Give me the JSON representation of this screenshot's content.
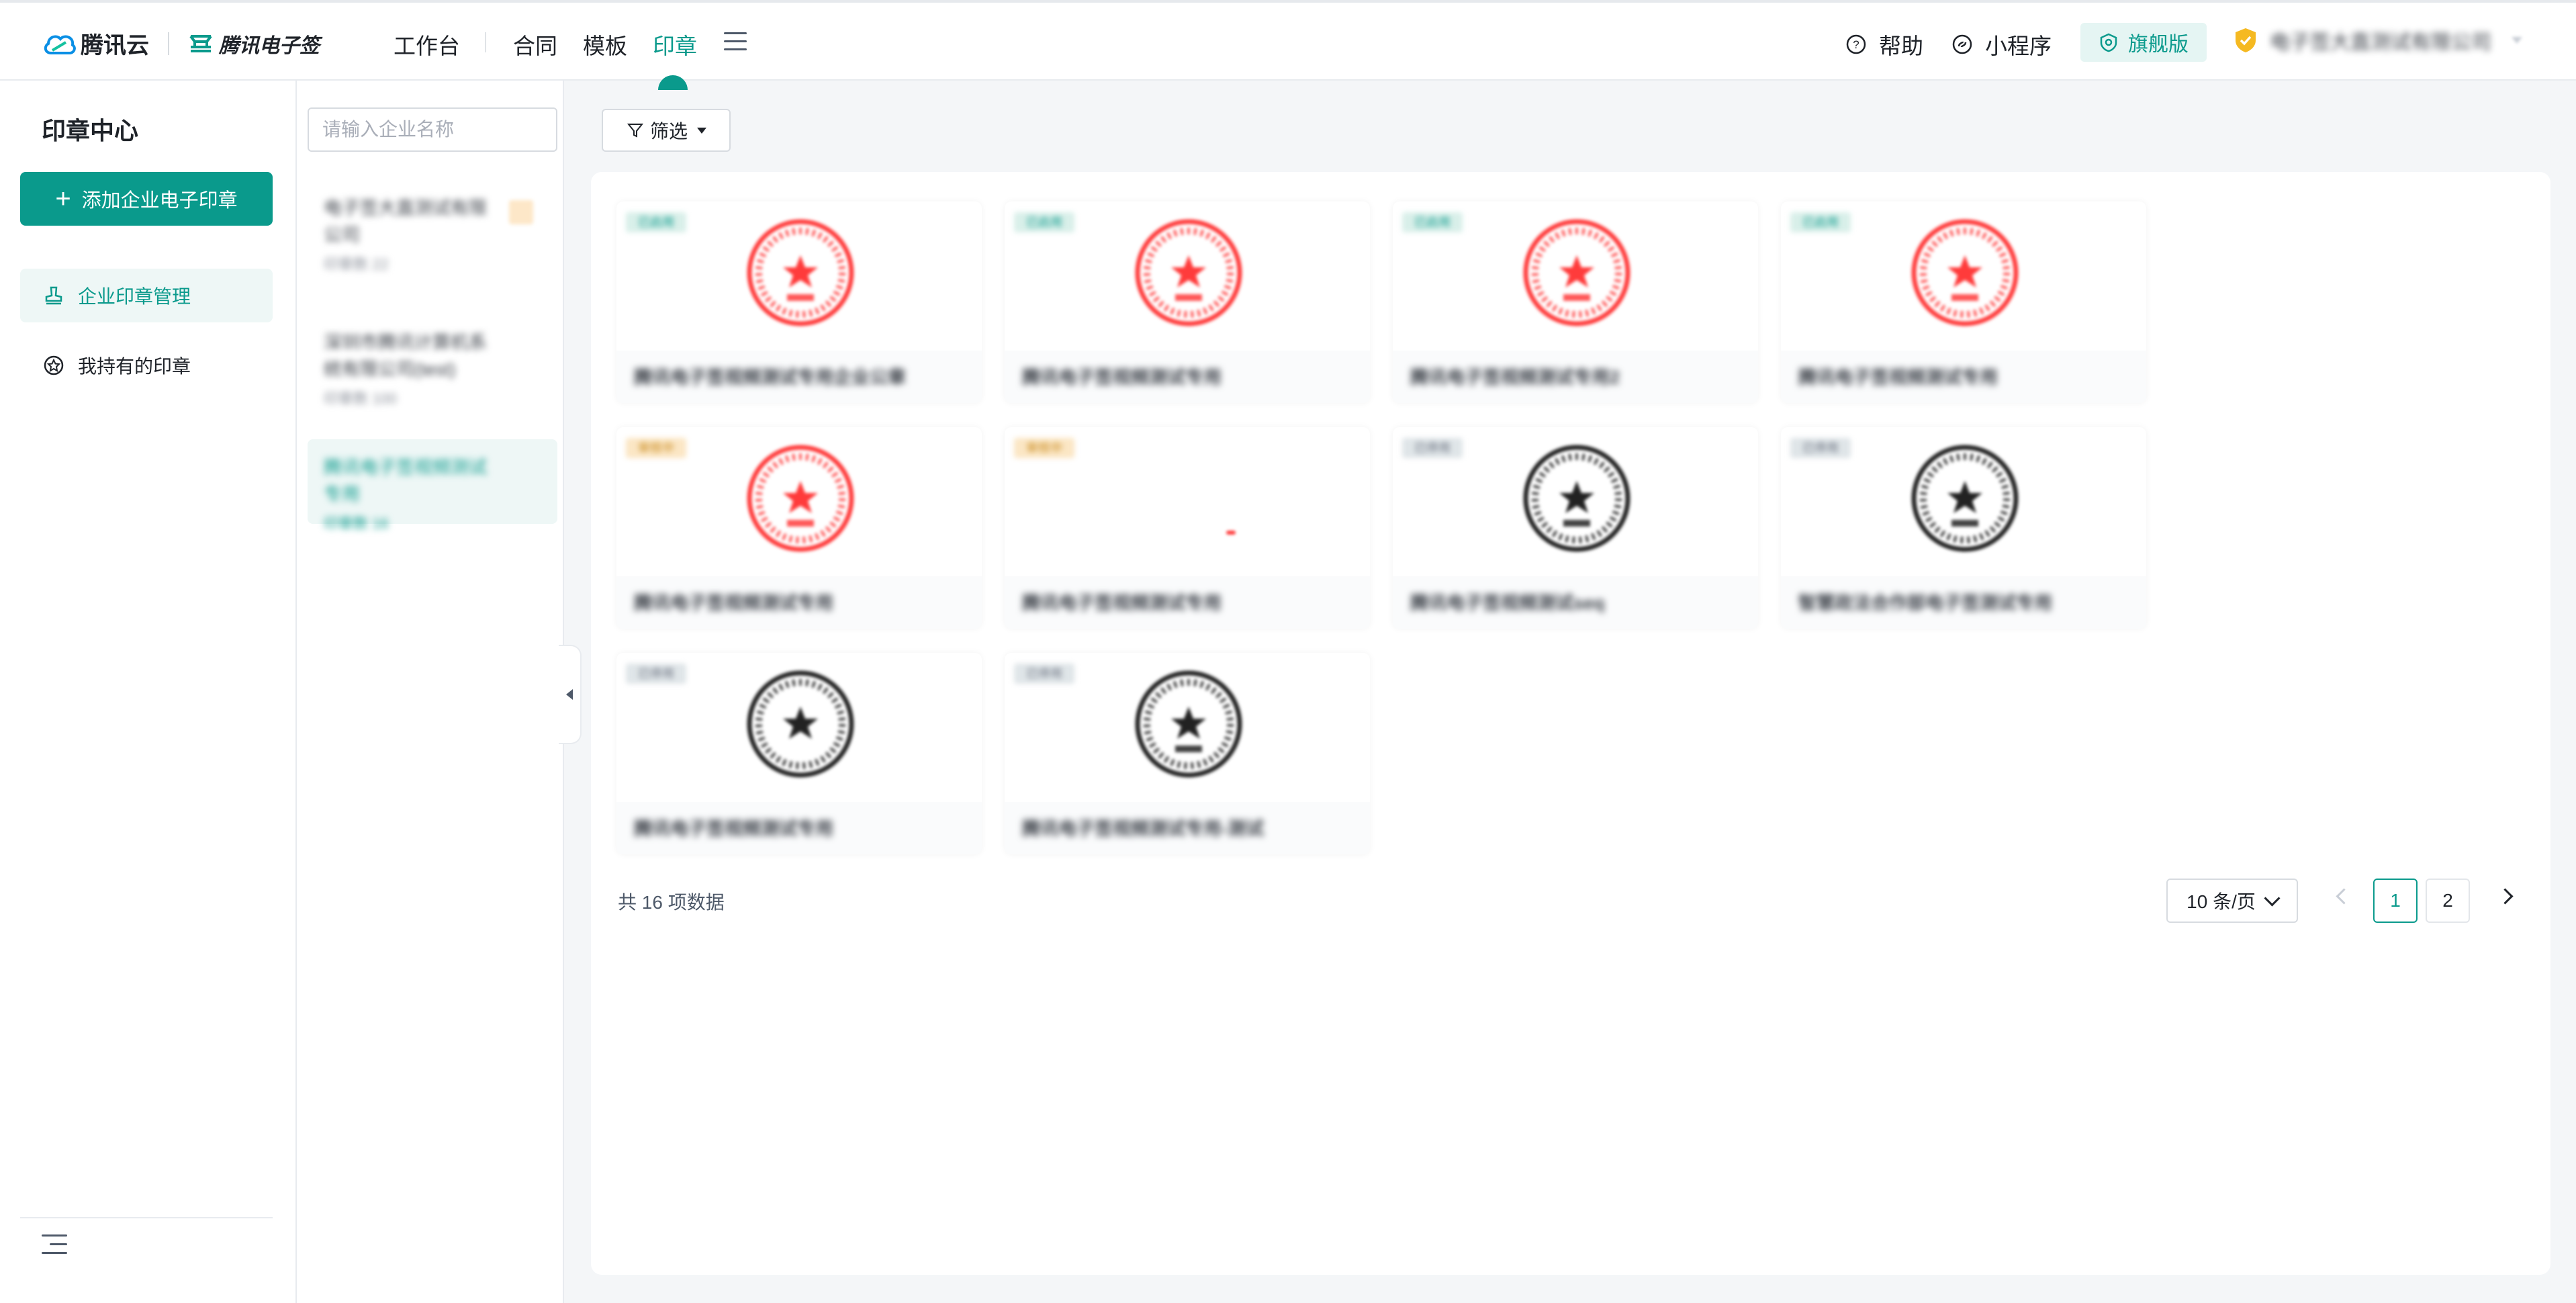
{
  "header": {
    "brand": "腾讯云",
    "product": "腾讯电子签",
    "workbench": "工作台",
    "nav": [
      "合同",
      "模板",
      "印章"
    ],
    "active_nav": "印章",
    "help": "帮助",
    "mini_program": "小程序",
    "edition": "旗舰版",
    "company": "电子签大直测试有限公司"
  },
  "sidebar": {
    "title": "印章中心",
    "add_button": "添加企业电子印章",
    "items": [
      {
        "label": "企业印章管理",
        "icon": "stamp-icon",
        "active": true
      },
      {
        "label": "我持有的印章",
        "icon": "star-circle-icon",
        "active": false
      }
    ]
  },
  "company_panel": {
    "search_placeholder": "请输入企业名称",
    "companies": [
      {
        "name": "电子签大直测试有限公司",
        "count": "印章数 22",
        "active": false
      },
      {
        "name": "深圳市腾讯计算机系统有限公司(test)",
        "count": "印章数 100",
        "active": false
      },
      {
        "name": "腾讯电子签视频测试专用",
        "count": "印章数 16",
        "active": true
      }
    ]
  },
  "main": {
    "filter_label": "筛选",
    "seals": [
      {
        "status": "已启用",
        "name": "腾讯电子签视频测试专用企业公章",
        "color": "#ff3b3b"
      },
      {
        "status": "已启用",
        "name": "腾讯电子签视频测试专用",
        "color": "#ff3b3b"
      },
      {
        "status": "已启用",
        "name": "腾讯电子签视频测试专用2",
        "color": "#ff3b3b"
      },
      {
        "status": "已启用",
        "name": "腾讯电子签视频测试专用",
        "color": "#ff3b3b"
      },
      {
        "status": "审核中",
        "name": "腾讯电子签视频测试专用",
        "color": "#ff3b3b"
      },
      {
        "status": "审核中",
        "name": "腾讯电子签视频测试专用",
        "color": "#ff3b3b"
      },
      {
        "status": "已停用",
        "name": "腾讯电子签视频测试seq",
        "color": "#222222"
      },
      {
        "status": "已停用",
        "name": "智慧政法合作部电子签测试专用",
        "color": "#222222"
      },
      {
        "status": "已停用",
        "name": "腾讯电子签视频测试专用",
        "color": "#222222"
      },
      {
        "status": "已停用",
        "name": "腾讯电子签视频测试专用-测试",
        "color": "#222222"
      }
    ],
    "total": "共 16 项数据",
    "page_size": "10 条/页",
    "pages": [
      "1",
      "2"
    ],
    "current_page": "1"
  }
}
